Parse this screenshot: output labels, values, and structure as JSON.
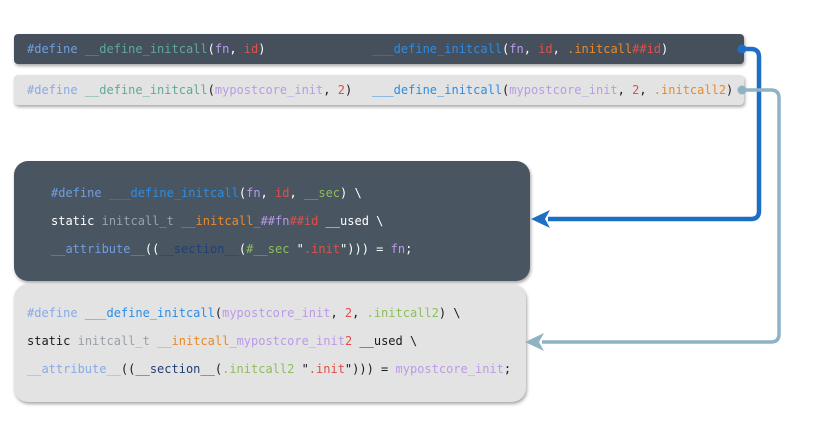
{
  "colors": {
    "dark_bg": "#46505c",
    "light_bg": "#e3e3e3",
    "arrow_primary": "#1e6fc4",
    "arrow_secondary": "#8fb3c4",
    "kw_dark": "#6f9fe0",
    "kw_light": "#8aa8e6",
    "fn_blue": "#2b8de6",
    "fn_teal": "#5fa89a",
    "arg_purple": "#b99be6",
    "id_red": "#e0504a",
    "orange": "#e88a2a",
    "green": "#8cbf5a",
    "white": "#ffffff",
    "black": "#1a1a1a",
    "gray": "#9aa0a8",
    "navy": "#1f3f73"
  },
  "bar1": {
    "left": [
      {
        "t": "#define",
        "c": "kw_dark"
      },
      {
        "t": " ",
        "c": "white"
      },
      {
        "t": "__define_initcall",
        "c": "fn_teal"
      },
      {
        "t": "(",
        "c": "white"
      },
      {
        "t": "fn",
        "c": "arg_purple"
      },
      {
        "t": ", ",
        "c": "white"
      },
      {
        "t": "id",
        "c": "id_red"
      },
      {
        "t": ")",
        "c": "white"
      }
    ],
    "right": [
      {
        "t": "___define_initcall",
        "c": "fn_blue"
      },
      {
        "t": "(",
        "c": "white"
      },
      {
        "t": "fn",
        "c": "arg_purple"
      },
      {
        "t": ", ",
        "c": "white"
      },
      {
        "t": "id",
        "c": "id_red"
      },
      {
        "t": ", ",
        "c": "white"
      },
      {
        "t": ".initcall",
        "c": "orange"
      },
      {
        "t": "##id",
        "c": "id_red"
      },
      {
        "t": ")",
        "c": "white"
      }
    ]
  },
  "bar2": {
    "left": [
      {
        "t": "#define",
        "c": "kw_light"
      },
      {
        "t": " ",
        "c": "black"
      },
      {
        "t": "__define_initcall",
        "c": "fn_teal"
      },
      {
        "t": "(",
        "c": "black"
      },
      {
        "t": "mypostcore_init",
        "c": "arg_purple"
      },
      {
        "t": ", ",
        "c": "black"
      },
      {
        "t": "2",
        "c": "id_red"
      },
      {
        "t": ")",
        "c": "black"
      }
    ],
    "right": [
      {
        "t": "___define_initcall",
        "c": "fn_blue"
      },
      {
        "t": "(",
        "c": "black"
      },
      {
        "t": "mypostcore_init",
        "c": "arg_purple"
      },
      {
        "t": ", ",
        "c": "black"
      },
      {
        "t": "2",
        "c": "id_red"
      },
      {
        "t": ", ",
        "c": "black"
      },
      {
        "t": ".initcall2",
        "c": "orange"
      },
      {
        "t": ")",
        "c": "black"
      }
    ]
  },
  "panel1": {
    "lines": [
      [
        {
          "t": "#define",
          "c": "kw_dark"
        },
        {
          "t": " ",
          "c": "white"
        },
        {
          "t": "___define_initcall",
          "c": "fn_blue"
        },
        {
          "t": "(",
          "c": "white"
        },
        {
          "t": "fn",
          "c": "arg_purple"
        },
        {
          "t": ", ",
          "c": "white"
        },
        {
          "t": "id",
          "c": "id_red"
        },
        {
          "t": ", ",
          "c": "white"
        },
        {
          "t": "__sec",
          "c": "green"
        },
        {
          "t": ") \\",
          "c": "white"
        }
      ],
      [
        {
          "t": "static",
          "c": "white"
        },
        {
          "t": " ",
          "c": "white"
        },
        {
          "t": "initcall_t",
          "c": "gray"
        },
        {
          "t": " ",
          "c": "white"
        },
        {
          "t": "__initcall_",
          "c": "orange"
        },
        {
          "t": "##fn",
          "c": "arg_purple"
        },
        {
          "t": "##id",
          "c": "id_red"
        },
        {
          "t": " __used \\",
          "c": "white"
        }
      ],
      [
        {
          "t": "__attribute__",
          "c": "kw_dark"
        },
        {
          "t": "((",
          "c": "white"
        },
        {
          "t": "__section__",
          "c": "navy"
        },
        {
          "t": "(",
          "c": "white"
        },
        {
          "t": "#__sec",
          "c": "green"
        },
        {
          "t": " \"",
          "c": "white"
        },
        {
          "t": ".init",
          "c": "id_red"
        },
        {
          "t": "\"))) = ",
          "c": "white"
        },
        {
          "t": "fn",
          "c": "arg_purple"
        },
        {
          "t": ";",
          "c": "white"
        }
      ]
    ]
  },
  "panel2": {
    "lines": [
      [
        {
          "t": "#define",
          "c": "kw_light"
        },
        {
          "t": " ",
          "c": "black"
        },
        {
          "t": "___define_initcall",
          "c": "fn_blue"
        },
        {
          "t": "(",
          "c": "black"
        },
        {
          "t": "mypostcore_init",
          "c": "arg_purple"
        },
        {
          "t": ", ",
          "c": "black"
        },
        {
          "t": "2",
          "c": "id_red"
        },
        {
          "t": ", ",
          "c": "black"
        },
        {
          "t": ".initcall2",
          "c": "green"
        },
        {
          "t": ") \\",
          "c": "black"
        }
      ],
      [
        {
          "t": "static",
          "c": "black"
        },
        {
          "t": " ",
          "c": "black"
        },
        {
          "t": "initcall_t",
          "c": "gray"
        },
        {
          "t": " ",
          "c": "black"
        },
        {
          "t": "__initcall_",
          "c": "orange"
        },
        {
          "t": "mypostcore_init",
          "c": "arg_purple"
        },
        {
          "t": "2",
          "c": "id_red"
        },
        {
          "t": " __used \\",
          "c": "black"
        }
      ],
      [
        {
          "t": "__attribute__",
          "c": "kw_light"
        },
        {
          "t": "((",
          "c": "black"
        },
        {
          "t": "__section__",
          "c": "navy"
        },
        {
          "t": "(",
          "c": "black"
        },
        {
          "t": ".initcall2",
          "c": "green"
        },
        {
          "t": " \"",
          "c": "black"
        },
        {
          "t": ".init",
          "c": "id_red"
        },
        {
          "t": "\"))) = ",
          "c": "black"
        },
        {
          "t": "mypostcore_init",
          "c": "arg_purple"
        },
        {
          "t": ";",
          "c": "black"
        }
      ]
    ]
  },
  "arrows": [
    {
      "from": "bar1",
      "to": "panel1",
      "color": "arrow_primary"
    },
    {
      "from": "bar2",
      "to": "panel2",
      "color": "arrow_secondary"
    }
  ]
}
